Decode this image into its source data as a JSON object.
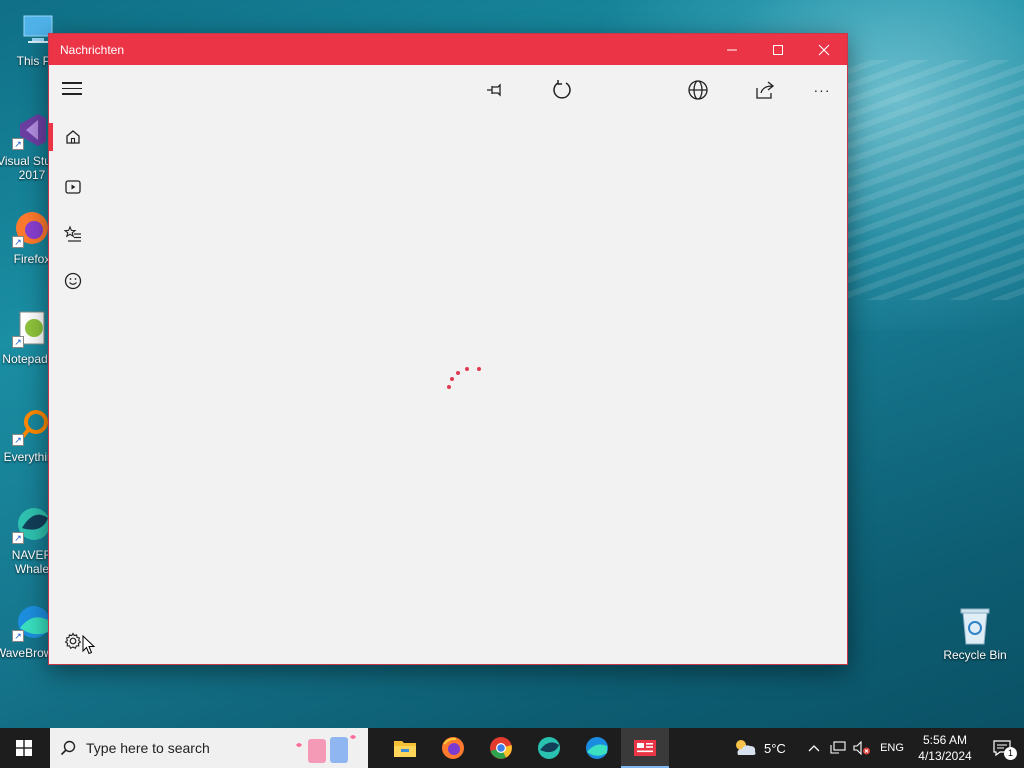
{
  "desktop": {
    "icons": [
      {
        "label": "This PC"
      },
      {
        "label": "Visual Studio 2017"
      },
      {
        "label": "Firefox"
      },
      {
        "label": "Notepad++"
      },
      {
        "label": "Everything"
      },
      {
        "label": "NAVER Whale"
      },
      {
        "label": "WaveBrowser"
      }
    ],
    "recycle_bin": {
      "label": "Recycle Bin"
    }
  },
  "window": {
    "title": "Nachrichten",
    "controls": {
      "minimize": "–",
      "maximize": "□",
      "close": "✕"
    },
    "accent_color": "#ec3447",
    "toolbar": {
      "menu_icon": "hamburger-icon",
      "icons": [
        "pin-icon",
        "refresh-icon",
        "dark-mode-icon",
        "globe-icon",
        "share-icon",
        "more-icon"
      ],
      "more_label": "···"
    },
    "nav": [
      {
        "icon": "home-icon",
        "active": true
      },
      {
        "icon": "video-icon",
        "active": false
      },
      {
        "icon": "favorites-icon",
        "active": false
      },
      {
        "icon": "smiley-icon",
        "active": false
      },
      {
        "icon": "settings-icon",
        "active": false
      }
    ],
    "state": "loading"
  },
  "taskbar": {
    "search_placeholder": "Type here to search",
    "apps": [
      "file-explorer-icon",
      "firefox-icon",
      "chrome-icon",
      "naver-whale-icon",
      "wavebrowser-icon",
      "news-app-icon"
    ],
    "weather": {
      "temp": "5°C"
    },
    "language": "ENG",
    "time": "5:56 AM",
    "date": "4/13/2024",
    "notification_count": "1"
  }
}
